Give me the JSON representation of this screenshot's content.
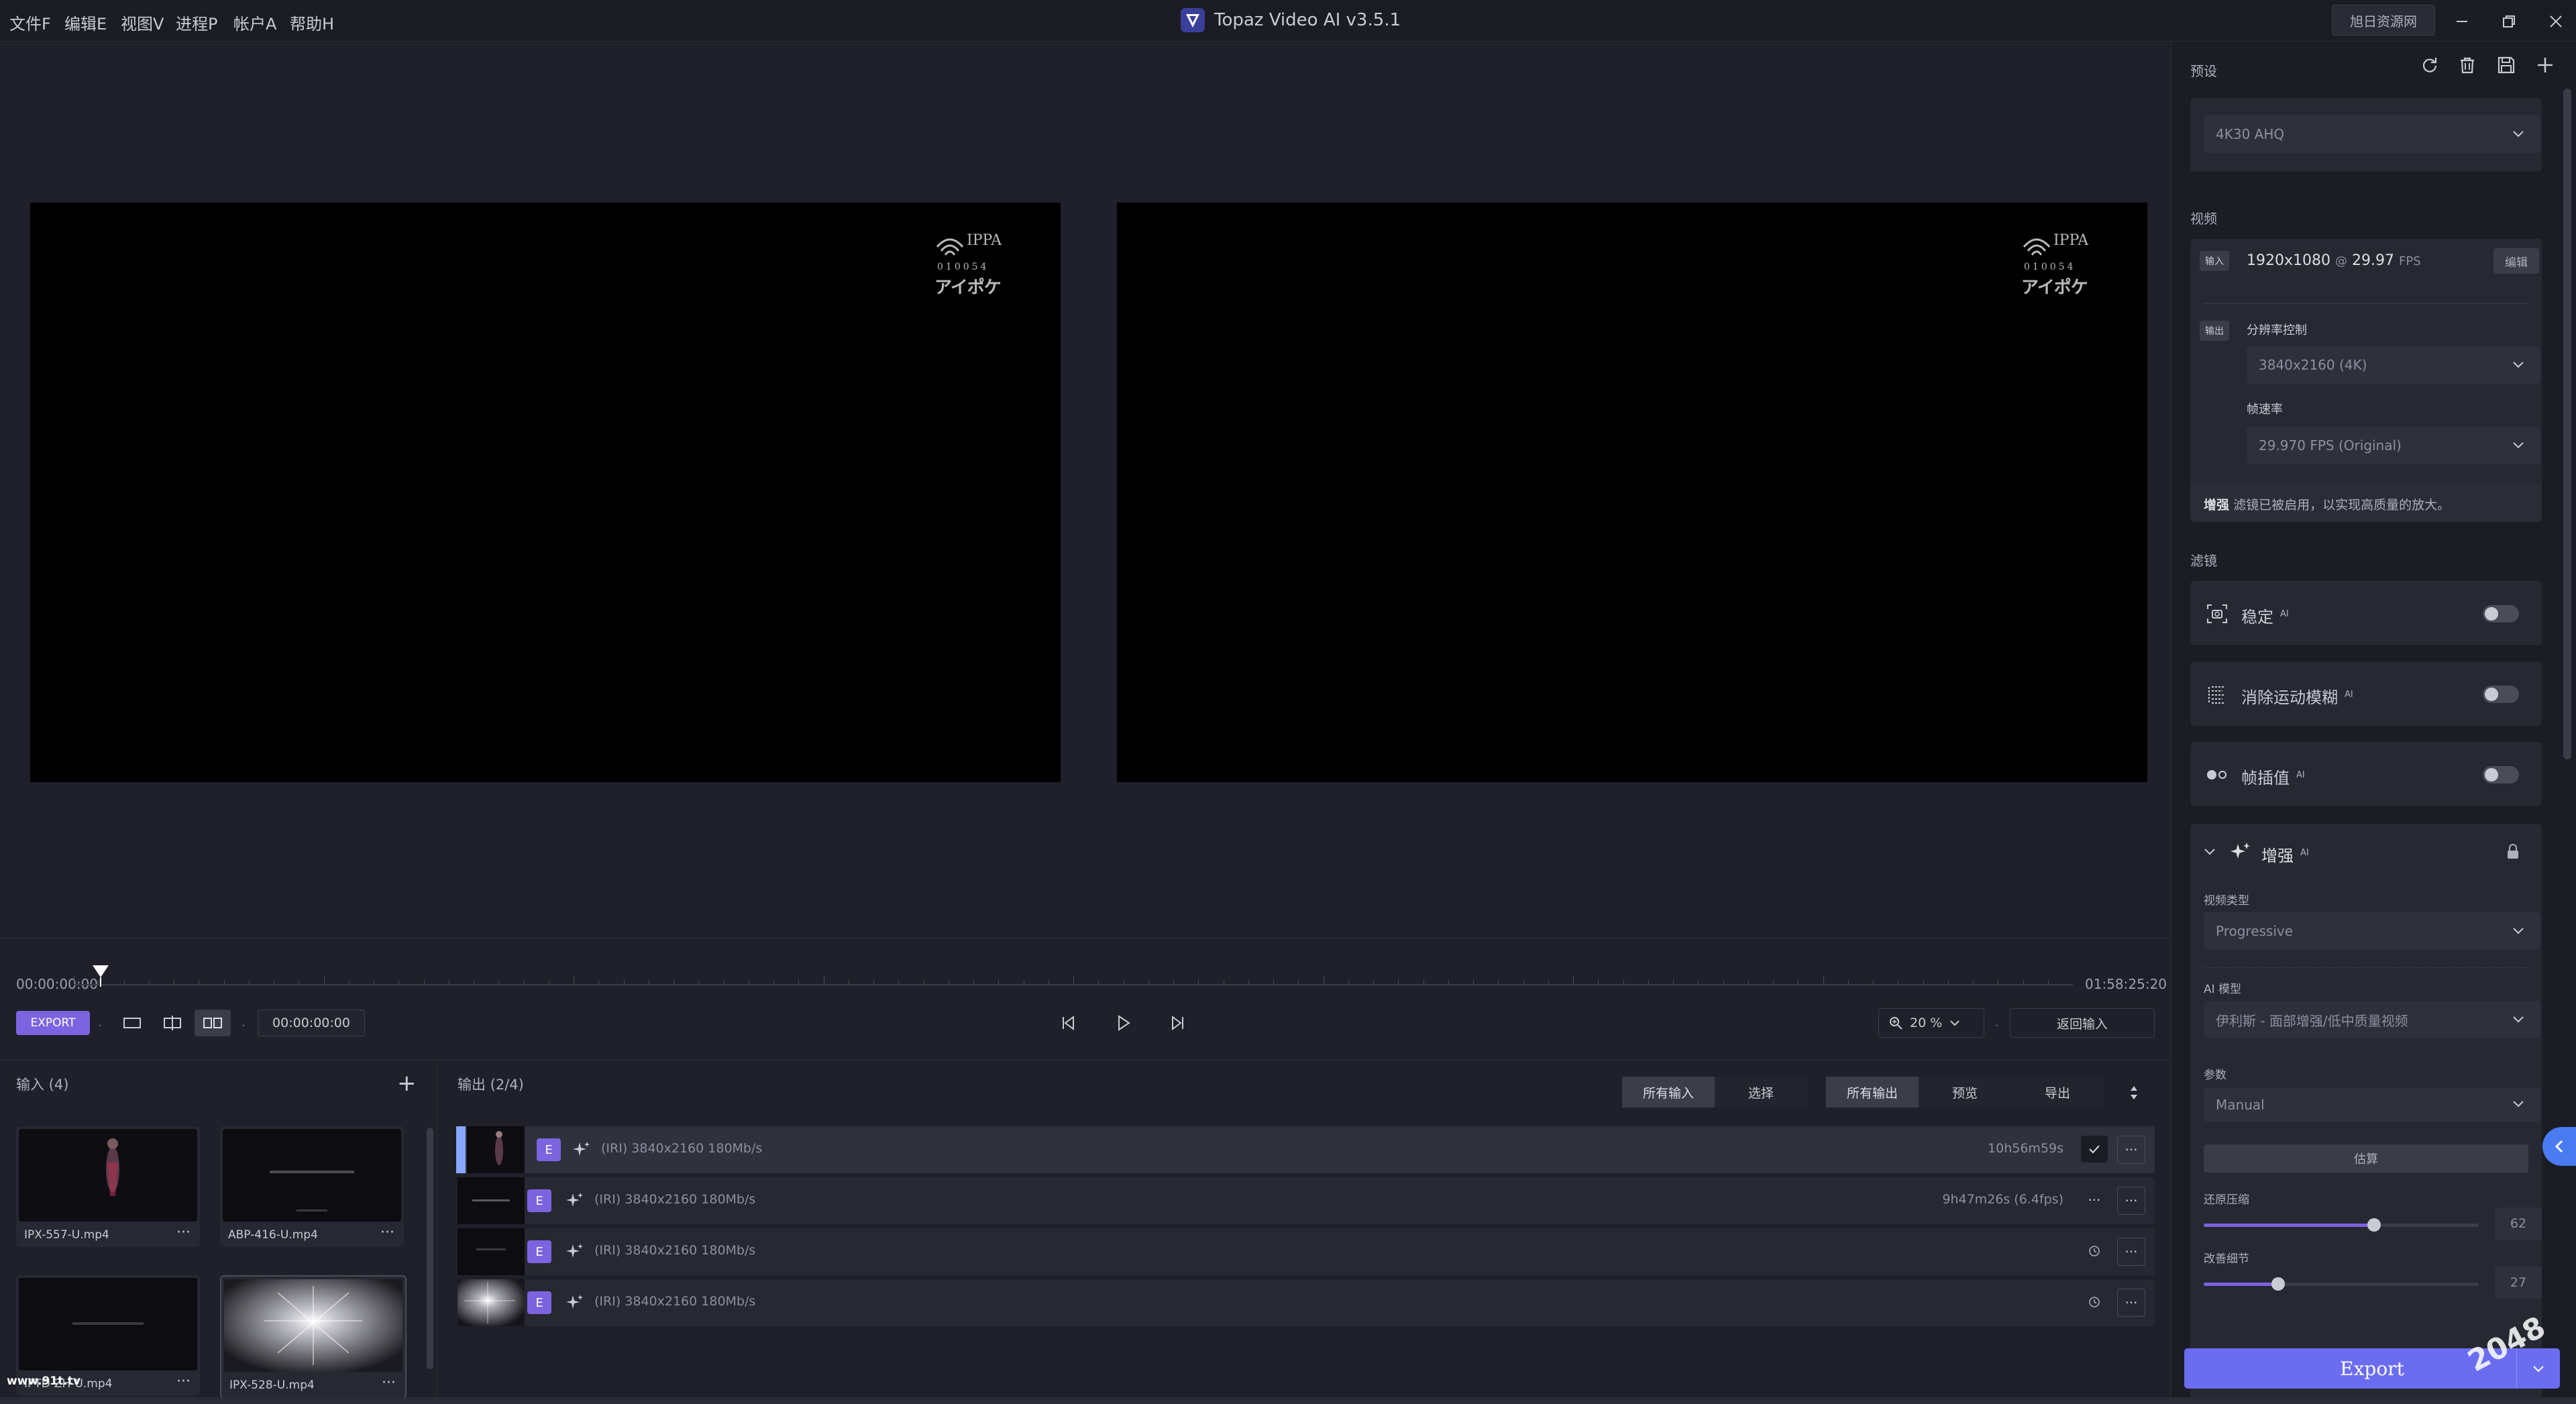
{
  "menu": [
    "文件F",
    "编辑E",
    "视图V",
    "进程P",
    "帐户A",
    "帮助H"
  ],
  "app_title": "Topaz Video AI  v3.5.1",
  "resource_button": "旭日资源网",
  "preview": {
    "watermark_top": "IPPA",
    "watermark_num": "010054",
    "watermark_kana": "アイポケ"
  },
  "timeline": {
    "start_time": "00:00:00:00",
    "end_time": "01:58:25:20",
    "export_small": "EXPORT",
    "timecode": "00:00:00:00",
    "zoom_value": "20 %",
    "return_input": "返回输入",
    "sep": "·"
  },
  "input_panel": {
    "title": "输入 (4)",
    "add": "+",
    "files": [
      {
        "name": "IPX-557-U.mp4"
      },
      {
        "name": "ABP-416-U.mp4"
      },
      {
        "name": "IPTD-ZH-U.mp4"
      },
      {
        "name": "IPX-528-U.mp4"
      }
    ],
    "more": "···",
    "brand": "www.91t.tv"
  },
  "output_panel": {
    "title": "输出 (2/4)",
    "filters": [
      "所有输入",
      "选择",
      "所有输出",
      "预览",
      "导出"
    ],
    "rows": [
      {
        "badge": "E",
        "spec": "(IRI) 3840x2160 180Mb/s",
        "status": "10h56m59s"
      },
      {
        "badge": "E",
        "spec": "(IRI) 3840x2160 180Mb/s",
        "status": "9h47m26s (6.4fps)"
      },
      {
        "badge": "E",
        "spec": "(IRI) 3840x2160 180Mb/s",
        "status": ""
      },
      {
        "badge": "E",
        "spec": "(IRI) 3840x2160 180Mb/s",
        "status": ""
      }
    ],
    "more": "···"
  },
  "right_panel": {
    "preset_label": "预设",
    "preset_value": "4K30 AHQ",
    "video_label": "视频",
    "input_tag": "输入",
    "input_res": "1920x1080",
    "input_at": "@",
    "input_fps": "29.97",
    "input_fps_unit": "FPS",
    "edit_btn": "编辑",
    "output_tag": "输出",
    "res_control_label": "分辨率控制",
    "res_value": "3840x2160 (4K)",
    "fps_label": "帧速率",
    "fps_value": "29.970 FPS (Original)",
    "enhance_note_bold": "增强",
    "enhance_note": "滤镜已被启用，以实现高质量的放大。",
    "filters_label": "滤镜",
    "filter_stabilize": "稳定",
    "filter_motion": "消除运动模糊",
    "filter_interp": "帧插值",
    "ai_sup": "AI",
    "enhance_title": "增强",
    "video_type_label": "视频类型",
    "video_type_value": "Progressive",
    "ai_model_label": "AI 模型",
    "ai_model_value": "伊利斯 - 面部增强/低中质量视频",
    "params_label": "参数",
    "params_value": "Manual",
    "estimate_btn": "估算",
    "compression_label": "还原压缩",
    "compression_value": "62",
    "compression_level": 0.62,
    "detail_label": "改善细节",
    "detail_value": "27",
    "detail_level": 0.27,
    "export_button": "Export"
  },
  "watermark_2048": "2048"
}
